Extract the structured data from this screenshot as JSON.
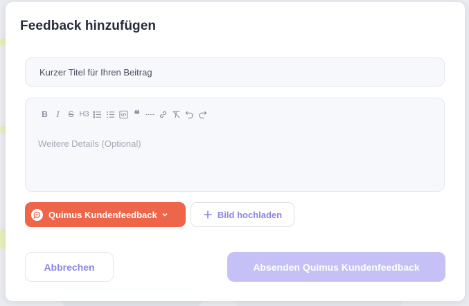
{
  "dialog": {
    "title": "Feedback hinzufügen"
  },
  "title_input": {
    "placeholder": "Kurzer Titel für Ihren Beitrag",
    "value": ""
  },
  "editor": {
    "toolbar": [
      {
        "name": "bold-icon",
        "glyph": "B"
      },
      {
        "name": "italic-icon",
        "glyph": "I"
      },
      {
        "name": "strikethrough-icon",
        "glyph": "S"
      },
      {
        "name": "heading3-icon",
        "glyph": "H3"
      },
      {
        "name": "bullet-list-icon"
      },
      {
        "name": "ordered-list-icon"
      },
      {
        "name": "code-block-icon"
      },
      {
        "name": "quote-icon"
      },
      {
        "name": "horizontal-rule-icon"
      },
      {
        "name": "link-icon"
      },
      {
        "name": "clear-format-icon"
      },
      {
        "name": "undo-icon"
      },
      {
        "name": "redo-icon"
      }
    ],
    "placeholder": "Weitere Details (Optional)"
  },
  "board_select": {
    "label": "Quimus Kundenfeedback",
    "color": "#ee6549"
  },
  "upload": {
    "label": "Bild hochladen",
    "color": "#8c84e3"
  },
  "actions": {
    "cancel_label": "Abbrechen",
    "submit_label": "Absenden Quimus Kundenfeedback",
    "submit_color": "#c5c1f7"
  }
}
